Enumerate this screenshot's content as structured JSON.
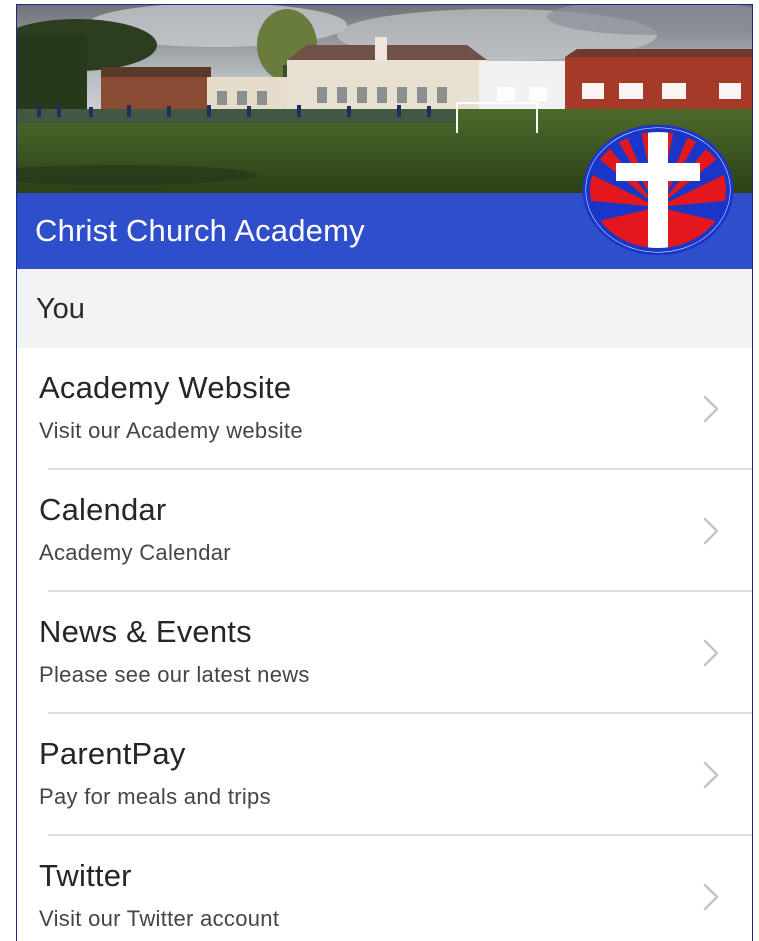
{
  "header": {
    "title": "Christ Church Academy"
  },
  "section": {
    "label": "You"
  },
  "menu": {
    "items": [
      {
        "title": "Academy Website",
        "subtitle": "Visit our Academy website",
        "icon": "chevron-right-icon"
      },
      {
        "title": "Calendar",
        "subtitle": "Academy Calendar",
        "icon": "chevron-right-icon"
      },
      {
        "title": "News & Events",
        "subtitle": "Please see our latest news",
        "icon": "chevron-right-icon"
      },
      {
        "title": "ParentPay",
        "subtitle": "Pay for meals and trips",
        "icon": "chevron-right-icon"
      },
      {
        "title": "Twitter",
        "subtitle": "Visit our Twitter account",
        "icon": "chevron-right-icon"
      }
    ]
  },
  "colors": {
    "brand_blue": "#2f4ecb",
    "logo_red": "#e4181c",
    "logo_blue": "#1a36c8",
    "logo_cross": "#ffffff",
    "section_bg": "#f3f2f5",
    "divider": "#dedede"
  }
}
